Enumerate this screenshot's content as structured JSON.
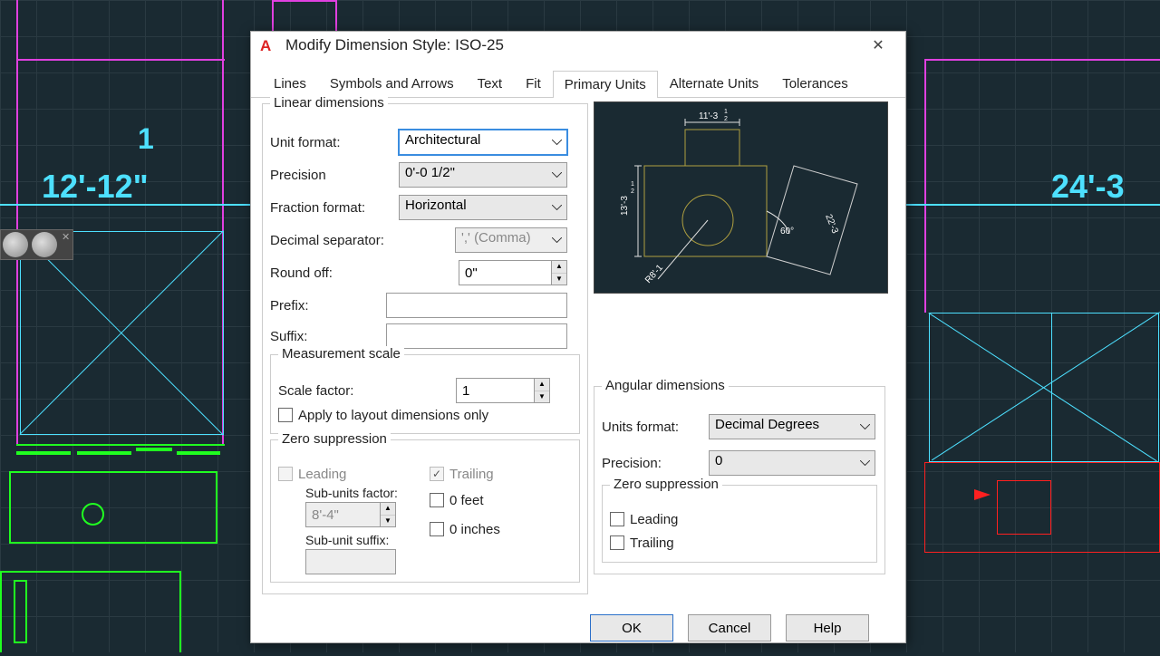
{
  "bg_dims": {
    "left": "12'-12\"",
    "left_frac": "1",
    "right": "24'-3"
  },
  "dialog": {
    "title": "Modify Dimension Style: ISO-25",
    "tabs": [
      "Lines",
      "Symbols and Arrows",
      "Text",
      "Fit",
      "Primary Units",
      "Alternate Units",
      "Tolerances"
    ],
    "active_tab": 4,
    "linear": {
      "legend": "Linear dimensions",
      "unit_format_lbl": "Unit format:",
      "unit_format": "Architectural",
      "precision_lbl": "Precision",
      "precision": "0'-0 1/2\"",
      "fraction_lbl": "Fraction format:",
      "fraction": "Horizontal",
      "decimal_lbl": "Decimal separator:",
      "decimal": "',' (Comma)",
      "round_lbl": "Round off:",
      "round": "0\"",
      "prefix_lbl": "Prefix:",
      "prefix": "",
      "suffix_lbl": "Suffix:",
      "suffix": ""
    },
    "scale": {
      "legend": "Measurement scale",
      "factor_lbl": "Scale factor:",
      "factor": "1",
      "apply_lbl": "Apply to layout dimensions only"
    },
    "zero": {
      "legend": "Zero suppression",
      "leading": "Leading",
      "trailing": "Trailing",
      "sub_factor_lbl": "Sub-units factor:",
      "sub_factor": "8'-4\"",
      "sub_suffix_lbl": "Sub-unit suffix:",
      "feet": "0 feet",
      "inches": "0 inches"
    },
    "angular": {
      "legend": "Angular dimensions",
      "format_lbl": "Units format:",
      "format": "Decimal Degrees",
      "precision_lbl": "Precision:",
      "precision": "0",
      "zero_legend": "Zero suppression",
      "leading": "Leading",
      "trailing": "Trailing"
    },
    "buttons": {
      "ok": "OK",
      "cancel": "Cancel",
      "help": "Help"
    }
  }
}
